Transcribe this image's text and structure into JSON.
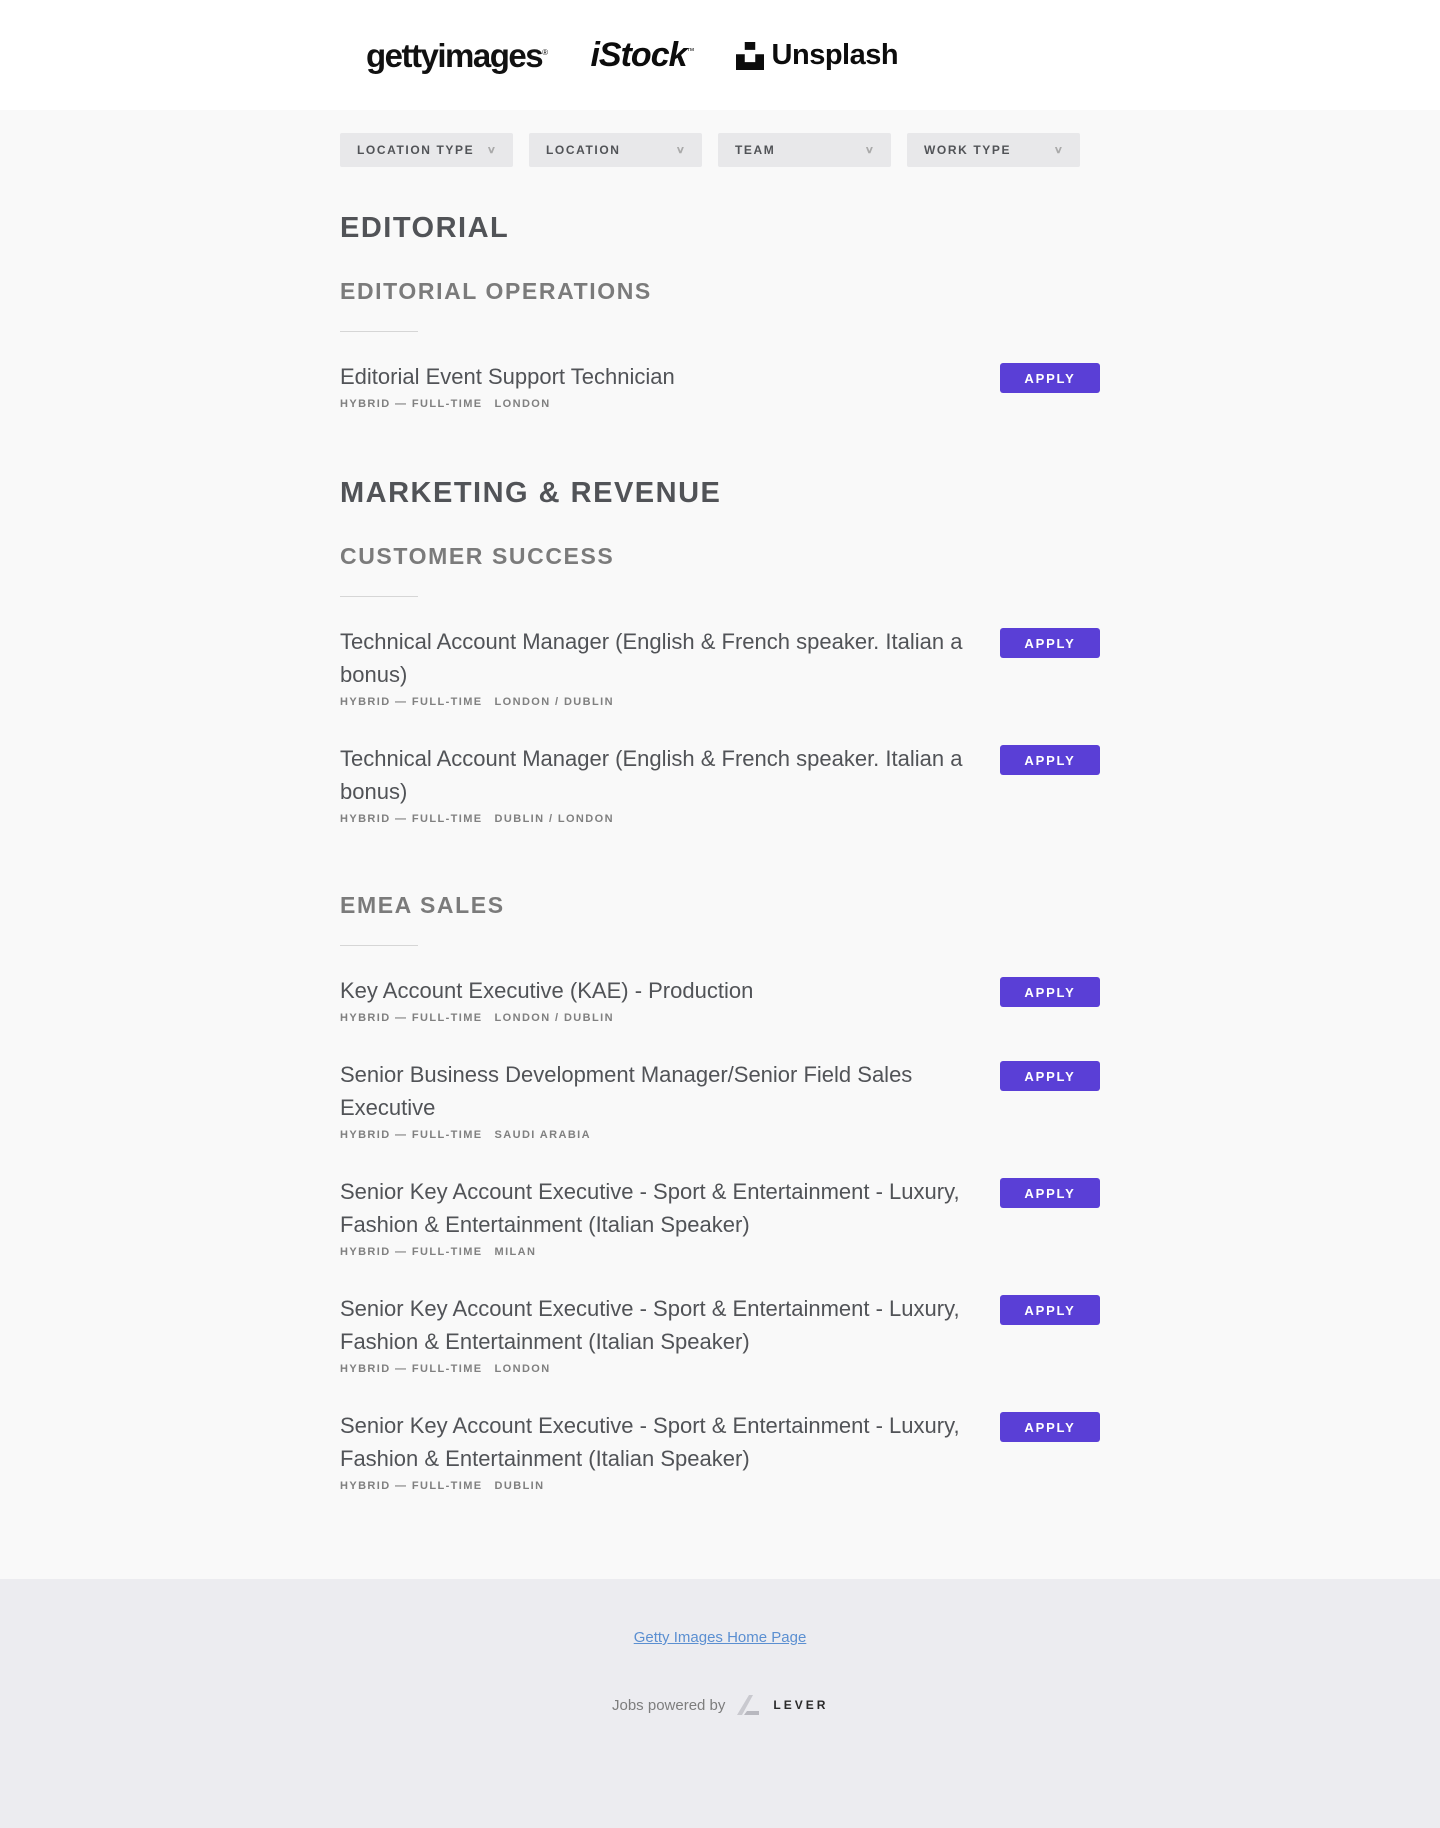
{
  "brands": {
    "getty": "gettyimages",
    "getty_mark": "®",
    "istock": "iStock",
    "istock_mark": "™",
    "unsplash": "Unsplash"
  },
  "filters": [
    {
      "label": "LOCATION TYPE"
    },
    {
      "label": "LOCATION"
    },
    {
      "label": "TEAM"
    },
    {
      "label": "WORK TYPE"
    }
  ],
  "apply_label": "APPLY",
  "departments": {
    "editorial": {
      "name": "EDITORIAL",
      "teams": {
        "operations": {
          "name": "EDITORIAL OPERATIONS",
          "postings": [
            {
              "title": "Editorial Event Support Technician",
              "commitment": "HYBRID — FULL-TIME",
              "location": "LONDON"
            }
          ]
        }
      }
    },
    "marketing": {
      "name": "MARKETING & REVENUE",
      "teams": {
        "customer_success": {
          "name": "CUSTOMER SUCCESS",
          "postings": [
            {
              "title": "Technical Account Manager (English & French speaker. Italian a bonus)",
              "commitment": "HYBRID — FULL-TIME",
              "location": "LONDON / DUBLIN"
            },
            {
              "title": "Technical Account Manager (English & French speaker. Italian a bonus)",
              "commitment": "HYBRID — FULL-TIME",
              "location": "DUBLIN / LONDON"
            }
          ]
        },
        "emea_sales": {
          "name": "EMEA SALES",
          "postings": [
            {
              "title": "Key Account Executive (KAE) - Production",
              "commitment": "HYBRID — FULL-TIME",
              "location": "LONDON / DUBLIN"
            },
            {
              "title": "Senior Business Development Manager/Senior Field Sales Executive",
              "commitment": "HYBRID — FULL-TIME",
              "location": "SAUDI ARABIA"
            },
            {
              "title": "Senior Key Account Executive - Sport & Entertainment - Luxury, Fashion & Entertainment (Italian Speaker)",
              "commitment": "HYBRID — FULL-TIME",
              "location": "MILAN"
            },
            {
              "title": "Senior Key Account Executive - Sport & Entertainment - Luxury, Fashion & Entertainment (Italian Speaker)",
              "commitment": "HYBRID — FULL-TIME",
              "location": "LONDON"
            },
            {
              "title": "Senior Key Account Executive - Sport & Entertainment - Luxury, Fashion & Entertainment (Italian Speaker)",
              "commitment": "HYBRID — FULL-TIME",
              "location": "DUBLIN"
            }
          ]
        }
      }
    }
  },
  "footer": {
    "home_link": "Getty Images Home Page",
    "powered_by": "Jobs powered by",
    "lever": "LEVER"
  },
  "colors": {
    "apply_button": "#5a3fd6",
    "link": "#5b8fd1"
  }
}
